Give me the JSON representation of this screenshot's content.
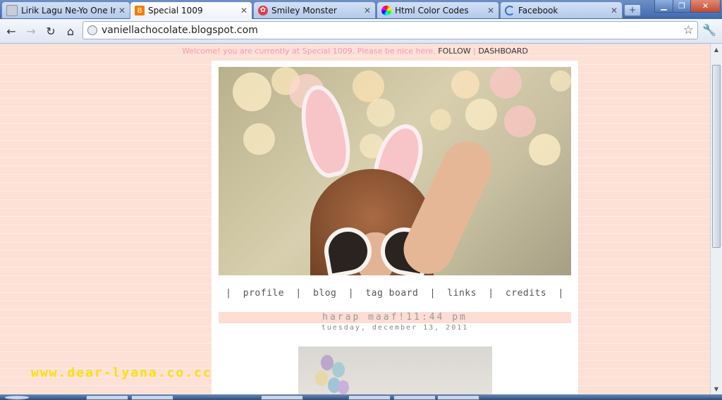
{
  "tabs": [
    {
      "title": "Lirik Lagu Ne-Yo One In",
      "favicon": "page-icon",
      "active": false
    },
    {
      "title": "Special 1009",
      "favicon": "blogger-icon",
      "active": true
    },
    {
      "title": "Smiley Monster",
      "favicon": "flower-icon",
      "active": false
    },
    {
      "title": "Html Color Codes",
      "favicon": "color-wheel-icon",
      "active": false
    },
    {
      "title": "Facebook",
      "favicon": "loading-icon",
      "active": false
    }
  ],
  "newtab_label": "+",
  "address": {
    "url": "vaniellachocolate.blogspot.com"
  },
  "page": {
    "welcome_message": "Welcome! you are currently at Special 1009. Please be nice here.",
    "follow_label": "FOLLOW",
    "separator": "|",
    "dashboard_label": "DASHBOARD",
    "menu": {
      "bar": "|",
      "items": [
        "profile",
        "blog",
        "tag board",
        "links",
        "credits"
      ]
    },
    "post": {
      "title": "harap maaf!11:44 pm",
      "date": "tuesday, december 13, 2011"
    },
    "watermark": "www.dear-lyana.co.cc"
  },
  "colors": {
    "page_bg": "#fde0d6",
    "welcome_text": "#f59aae",
    "title_bar": "#fddcd4",
    "watermark": "#f7e20c"
  }
}
